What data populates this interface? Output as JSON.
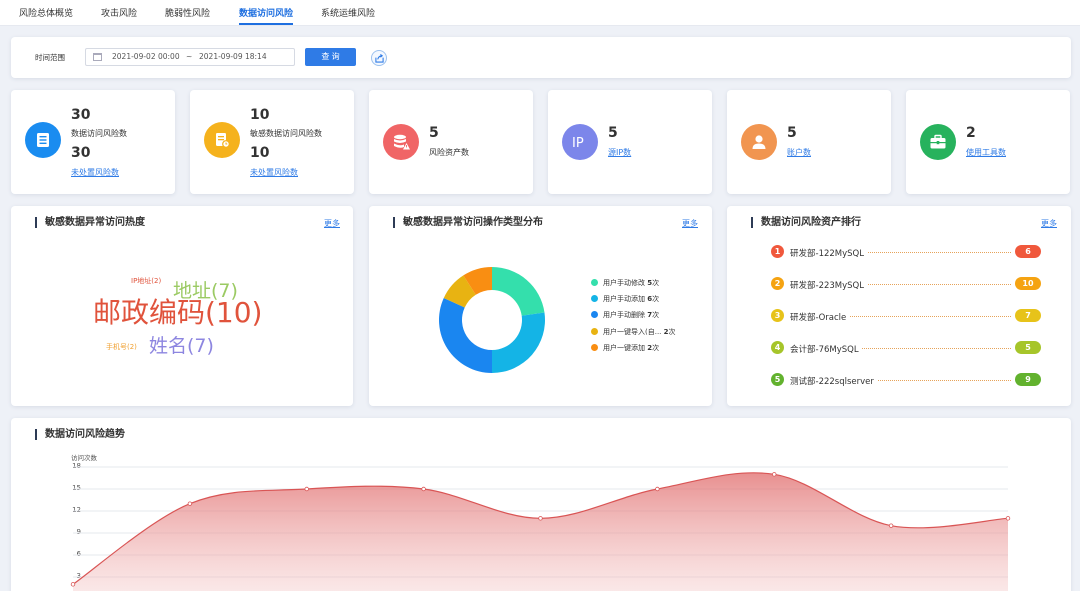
{
  "tabs": [
    {
      "label": "风险总体概览",
      "active": false
    },
    {
      "label": "攻击风险",
      "active": false
    },
    {
      "label": "脆弱性风险",
      "active": false
    },
    {
      "label": "数据访问风险",
      "active": true
    },
    {
      "label": "系统运维风险",
      "active": false
    }
  ],
  "filter": {
    "label": "时间范围",
    "start": "2021-09-02 00:00",
    "separator": "~",
    "end": "2021-09-09 18:14",
    "query_label": "查 询"
  },
  "stats": [
    {
      "value1": "30",
      "label1": "数据访问风险数",
      "value2": "30",
      "link": "未处置风险数",
      "color": "#1a8cf0",
      "icon": "list-icon"
    },
    {
      "value1": "10",
      "label1": "敏感数据访问风险数",
      "value2": "10",
      "link": "未处置风险数",
      "color": "#f5b21d",
      "icon": "document-icon"
    },
    {
      "value1": "5",
      "label1": "风险资产数",
      "color": "#f06566",
      "icon": "database-warning-icon"
    },
    {
      "value1": "5",
      "link": "源IP数",
      "color": "#7c86ea",
      "icon": "ip-icon"
    },
    {
      "value1": "5",
      "link": "账户数",
      "color": "#f19550",
      "icon": "user-icon"
    },
    {
      "value1": "2",
      "link": "使用工具数",
      "color": "#27b25d",
      "icon": "toolbox-icon"
    }
  ],
  "panels": {
    "wordcloud": {
      "title": "敏感数据异常访问热度",
      "more": "更多"
    },
    "donut": {
      "title": "敏感数据异常访问操作类型分布",
      "more": "更多"
    },
    "ranking": {
      "title": "数据访问风险资产排行",
      "more": "更多"
    },
    "trend": {
      "title": "数据访问风险趋势",
      "axis_title": "访问次数"
    }
  },
  "wordcloud": [
    {
      "text": "IP地址(2)",
      "color": "#e0533c"
    },
    {
      "text": "地址(7)",
      "color": "#9bca63"
    },
    {
      "text": "邮政编码(10)",
      "color": "#e0533c"
    },
    {
      "text": "手机号(2)",
      "color": "#f0a030"
    },
    {
      "text": "姓名(7)",
      "color": "#8d86e0"
    }
  ],
  "donut_legend": [
    {
      "name": "用户手动修改",
      "value": "5",
      "unit": "次",
      "color": "#34dfac"
    },
    {
      "name": "用户手动添加",
      "value": "6",
      "unit": "次",
      "color": "#14b4e6"
    },
    {
      "name": "用户手动删除",
      "value": "7",
      "unit": "次",
      "color": "#1a86f0"
    },
    {
      "name": "用户一键导入(自...",
      "value": "2",
      "unit": "次",
      "color": "#e8b312"
    },
    {
      "name": "用户一键添加",
      "value": "2",
      "unit": "次",
      "color": "#f98e12"
    }
  ],
  "ranking": [
    {
      "rank": "1",
      "name": "研发部-122MySQL",
      "value": "6",
      "color": "#f0583c"
    },
    {
      "rank": "2",
      "name": "研发部-223MySQL",
      "value": "10",
      "color": "#f5a312"
    },
    {
      "rank": "3",
      "name": "研发部-Oracle",
      "value": "7",
      "color": "#e7c31a"
    },
    {
      "rank": "4",
      "name": "会计部-76MySQL",
      "value": "5",
      "color": "#a6c52a"
    },
    {
      "rank": "5",
      "name": "测试部-222sqlserver",
      "value": "9",
      "color": "#62b22e"
    }
  ],
  "chart_data": {
    "type": "area",
    "ylabel": "访问次数",
    "ylim": [
      0,
      18
    ],
    "yticks": [
      3,
      6,
      9,
      12,
      15,
      18
    ],
    "values": [
      2,
      13,
      15,
      15,
      11,
      15,
      17,
      10,
      11
    ],
    "color": "#e06a6a"
  }
}
